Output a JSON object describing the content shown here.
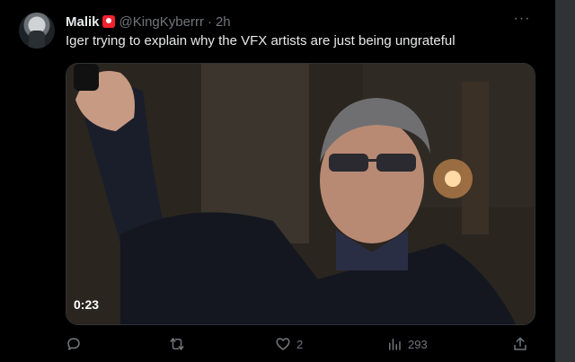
{
  "tweet": {
    "name": "Malik",
    "handle": "@KingKyberrr",
    "separator": "·",
    "time": "2h",
    "text": "Iger trying to explain why the VFX artists are just being ungrateful",
    "more_label": "···"
  },
  "media": {
    "duration": "0:23"
  },
  "actions": {
    "reply_count": "",
    "retweet_count": "",
    "like_count": "2",
    "views_count": "293"
  },
  "colors": {
    "background": "#000000",
    "text": "#e7e9ea",
    "muted": "#71767b",
    "badge": "#f4212e",
    "border": "#2f3336"
  },
  "icons": [
    "reply-icon",
    "retweet-icon",
    "like-icon",
    "views-icon",
    "share-icon",
    "more-icon",
    "verified-badge-icon"
  ]
}
